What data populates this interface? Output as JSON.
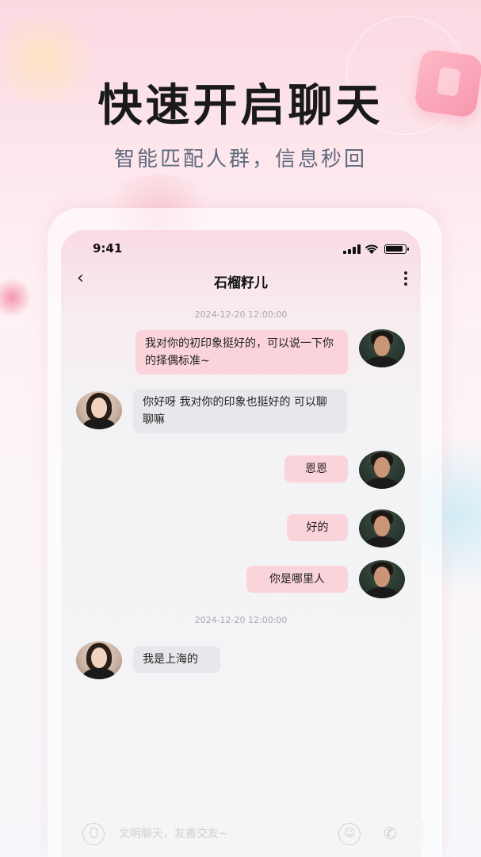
{
  "promo": {
    "headline": "快速开启聊天",
    "subline": "智能匹配人群，信息秒回"
  },
  "status_bar": {
    "time": "9:41"
  },
  "chat_header": {
    "back_icon": "chevron-left-icon",
    "title": "石榴籽儿",
    "more_icon": "more-vertical-icon"
  },
  "messages": [
    {
      "type": "timestamp",
      "text": "2024-12-20 12:00:00"
    },
    {
      "type": "message",
      "side": "out",
      "text": "我对你的初印象挺好的，可以说一下你的择偶标准~"
    },
    {
      "type": "message",
      "side": "in",
      "text": "你好呀 我对你的印象也挺好的 可以聊聊嘛"
    },
    {
      "type": "message",
      "side": "out",
      "text": "恩恩"
    },
    {
      "type": "message",
      "side": "out",
      "text": "好的"
    },
    {
      "type": "message",
      "side": "out",
      "text": "你是哪里人"
    },
    {
      "type": "timestamp",
      "text": "2024-12-20 12:00:00"
    },
    {
      "type": "message",
      "side": "in",
      "text": "我是上海的"
    }
  ],
  "input_bar": {
    "mic_icon": "microphone-icon",
    "placeholder": "文明聊天，友善交友~",
    "emoji_icon": "emoji-icon",
    "call_icon": "phone-icon"
  },
  "colors": {
    "out_bubble": "#fbd3da",
    "in_bubble": "#e9e7eb",
    "headline": "#1a1a1a",
    "subline": "#5f6b7e"
  }
}
